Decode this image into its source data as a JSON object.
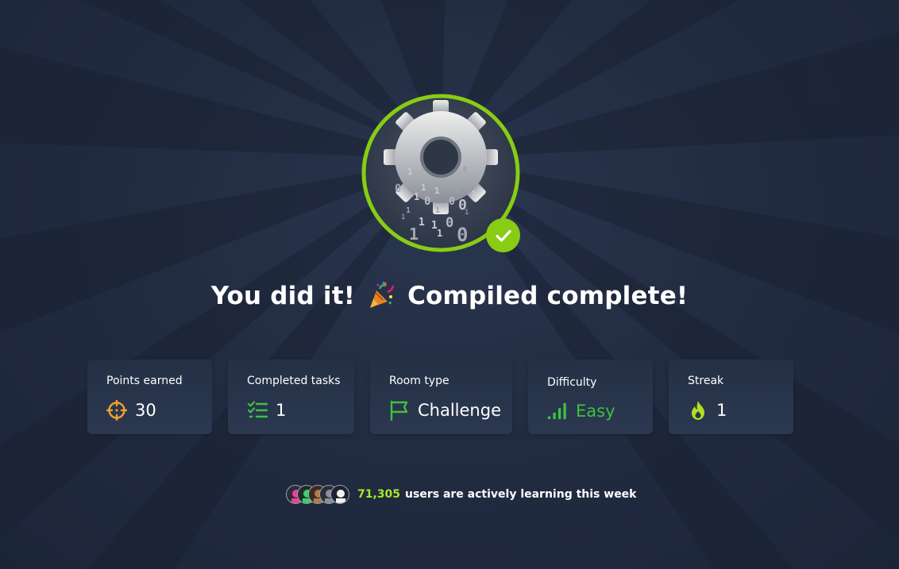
{
  "headline": {
    "prefix": "You did it!",
    "suffix": "Compiled complete!",
    "emoji_icon": "party-popper-icon"
  },
  "badge": {
    "icon": "gear-binary-badge-icon",
    "status_icon": "check-icon",
    "ring_color": "#88cc14"
  },
  "stats": [
    {
      "label": "Points earned",
      "value": "30",
      "icon": "crosshair-icon"
    },
    {
      "label": "Completed tasks",
      "value": "1",
      "icon": "checklist-icon"
    },
    {
      "label": "Room type",
      "value": "Challenge",
      "icon": "flag-icon"
    },
    {
      "label": "Difficulty",
      "value": "Easy",
      "icon": "signal-bars-icon"
    },
    {
      "label": "Streak",
      "value": "1",
      "icon": "flame-icon"
    }
  ],
  "footer": {
    "count": "71,305",
    "text": "users are actively learning this week",
    "avatar_icons": [
      "avatar-pink-icon",
      "avatar-green-icon",
      "avatar-brown-icon",
      "avatar-grey-icon",
      "avatar-white-icon"
    ]
  },
  "colors": {
    "background": "#212c42",
    "accent_green": "#88cc14",
    "easy_green": "#40c040",
    "icon_orange": "#f0a030",
    "count_green": "#a3ea2a"
  }
}
